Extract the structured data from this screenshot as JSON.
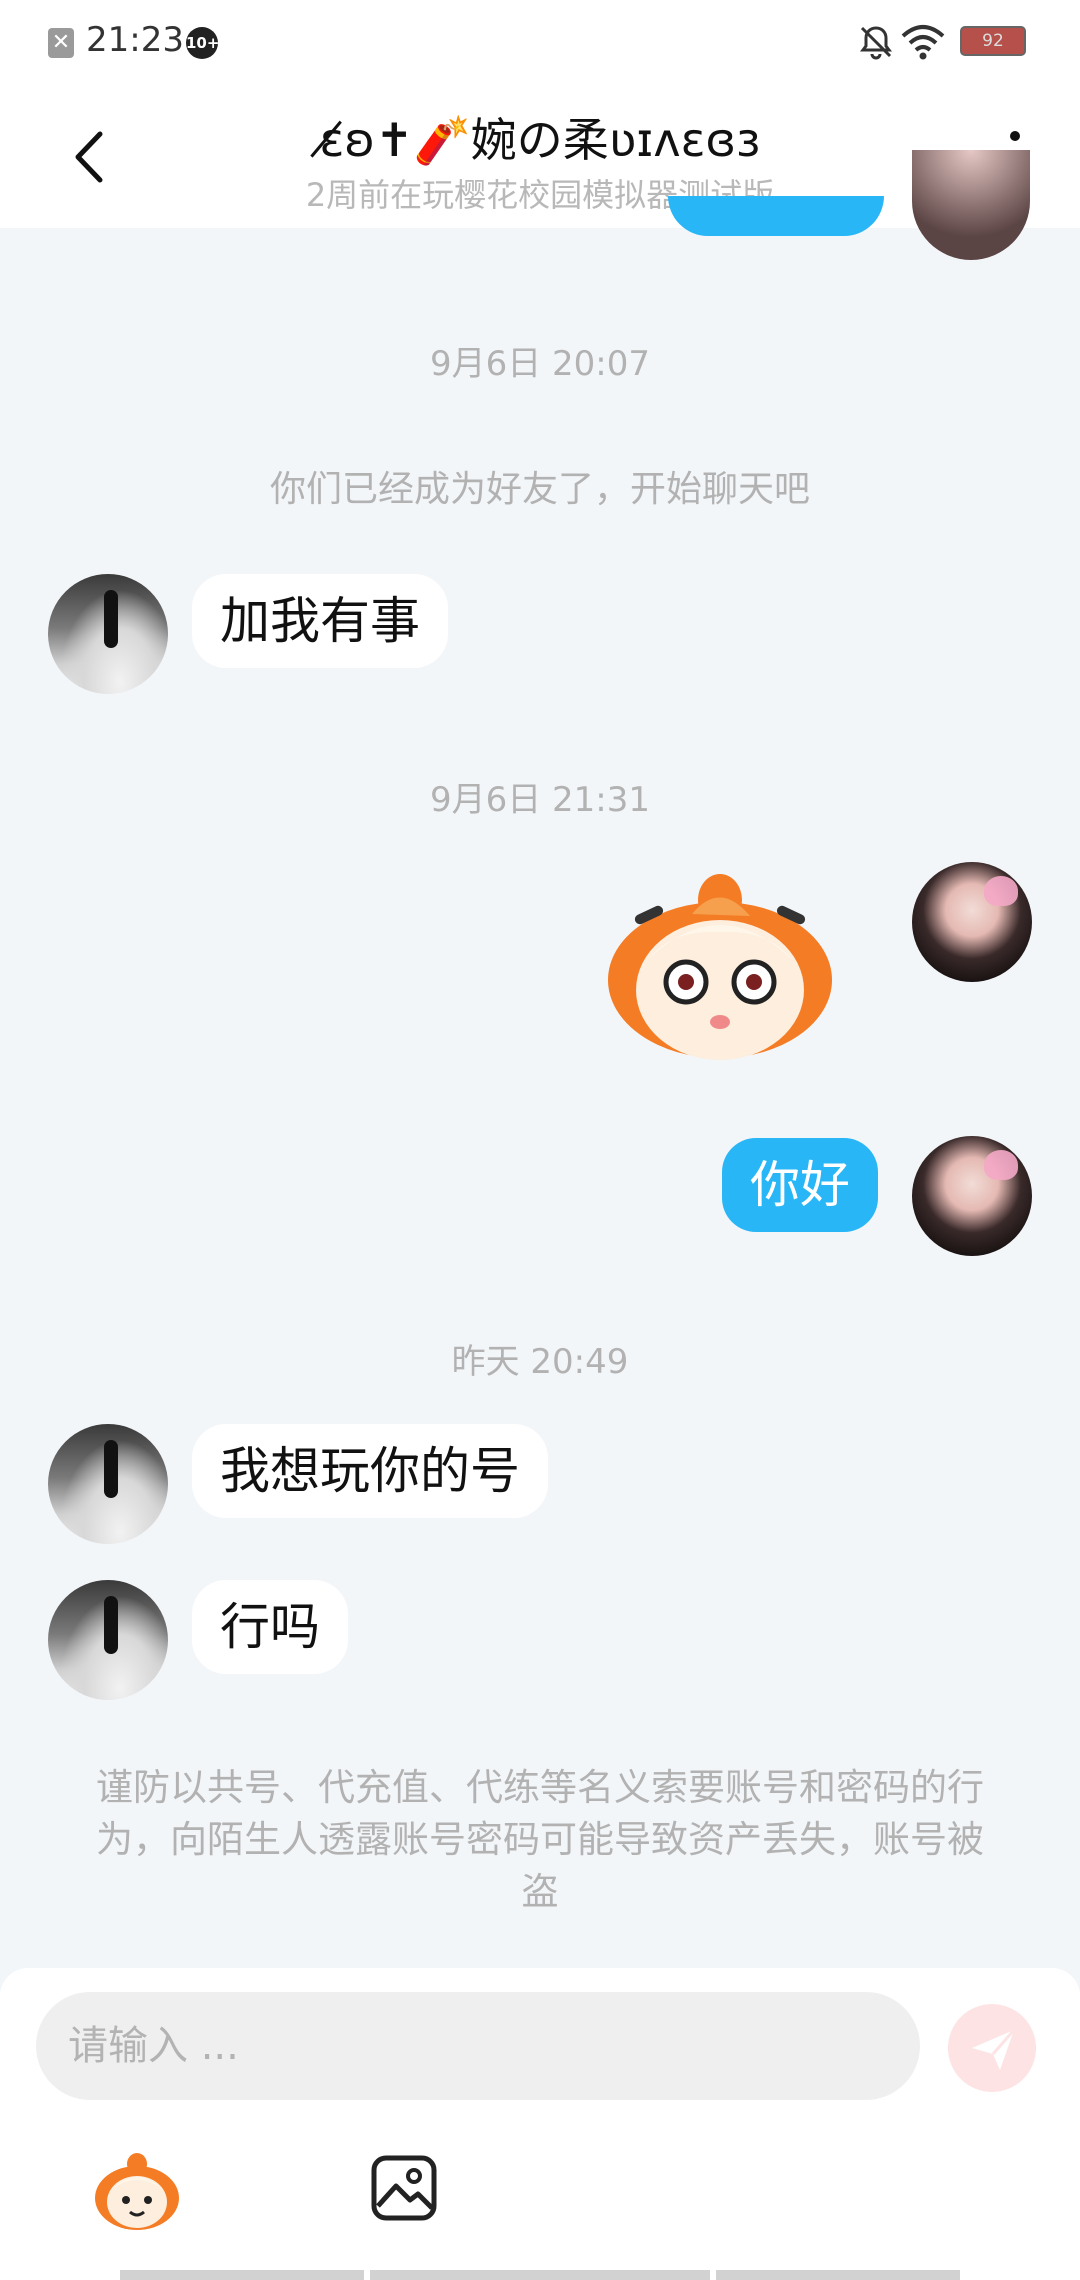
{
  "status_bar": {
    "time": "21:23",
    "notification_badge": "10+",
    "battery_level": "92",
    "icons": [
      "close-notification-icon",
      "bell-muted-icon",
      "wifi-icon",
      "battery-icon"
    ]
  },
  "header": {
    "title": "ɛ̸ʚ✝︎🧨婉の柔ʋɪʌɛɞɜ",
    "subtitle": "2周前在玩樱花校园模拟器测试版",
    "icons": [
      "back-arrow-icon",
      "more-vert-icon"
    ]
  },
  "messages": [
    {
      "type": "timestamp",
      "text": "9月6日 20:07"
    },
    {
      "type": "notice",
      "text": "你们已经成为好友了，开始聊天吧"
    },
    {
      "type": "text",
      "from": "other",
      "text": "加我有事"
    },
    {
      "type": "timestamp",
      "text": "9月6日 21:31"
    },
    {
      "type": "sticker",
      "from": "self",
      "sticker": "orange-hair-kid-face-sticker"
    },
    {
      "type": "text",
      "from": "self",
      "text": "你好"
    },
    {
      "type": "timestamp",
      "text": "昨天 20:49"
    },
    {
      "type": "text",
      "from": "other",
      "text": "我想玩你的号"
    },
    {
      "type": "text",
      "from": "other",
      "text": "行吗"
    }
  ],
  "warning": "谨防以共号、代充值、代练等名义索要账号和密码的行为，向陌生人透露账号密码可能导致资产丢失，账号被盗",
  "composer": {
    "placeholder": "请输入 ...",
    "icons": [
      "send-icon",
      "emoji-sticker-icon",
      "image-picker-icon"
    ]
  },
  "colors": {
    "background": "#f3f6f9",
    "bubble_out": "#29b6f6",
    "bubble_in": "#ffffff",
    "secondary_text": "#b2b2b2",
    "send_button_disabled": "#fde3e3"
  }
}
